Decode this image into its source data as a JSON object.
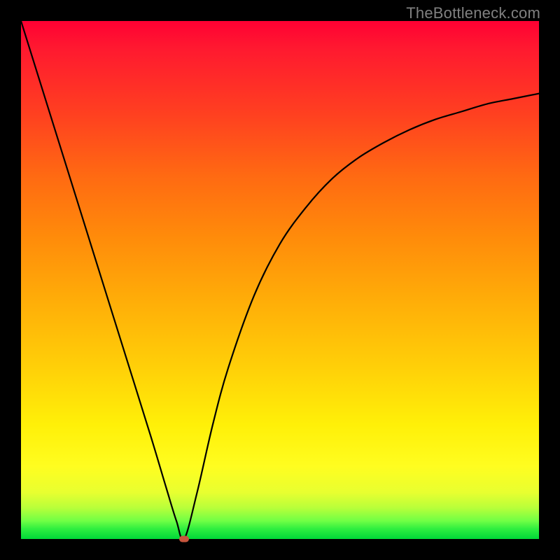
{
  "watermark": "TheBottleneck.com",
  "chart_data": {
    "type": "line",
    "title": "",
    "xlabel": "",
    "ylabel": "",
    "xlim": [
      0,
      100
    ],
    "ylim": [
      0,
      100
    ],
    "grid": false,
    "legend": false,
    "series": [
      {
        "name": "bottleneck-curve",
        "x": [
          0,
          5,
          10,
          15,
          20,
          25,
          28,
          30,
          31.5,
          34,
          37,
          40,
          45,
          50,
          55,
          60,
          65,
          70,
          75,
          80,
          85,
          90,
          95,
          100
        ],
        "values": [
          100,
          84,
          68,
          52,
          36,
          20,
          10,
          3.5,
          0,
          9,
          22,
          33,
          47,
          57,
          64,
          69.5,
          73.5,
          76.5,
          79,
          81,
          82.5,
          84,
          85,
          86
        ]
      }
    ],
    "annotations": [
      {
        "name": "minimum-marker",
        "x": 31.5,
        "y": 0,
        "color": "#c7553d"
      }
    ],
    "background_gradient": {
      "top": "#ff0033",
      "mid_upper": "#ff8c0a",
      "mid_lower": "#fff008",
      "bottom": "#00d838"
    }
  }
}
